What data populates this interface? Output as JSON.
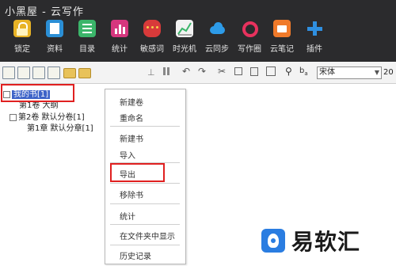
{
  "app": {
    "title": "小黑屋 - 云写作"
  },
  "ribbon": {
    "items": [
      {
        "label": "锁定",
        "icon": "lock-icon",
        "color": "#e8b326"
      },
      {
        "label": "资料",
        "icon": "book-icon",
        "color": "#2b8fd6"
      },
      {
        "label": "目录",
        "icon": "list-icon",
        "color": "#3bb56a"
      },
      {
        "label": "统计",
        "icon": "stats-icon",
        "color": "#d6367e"
      },
      {
        "label": "敏感词",
        "icon": "sensitive-words-icon",
        "color": "#d83a3a"
      },
      {
        "label": "时光机",
        "icon": "time-machine-icon",
        "color": "#e8e8e8"
      },
      {
        "label": "云同步",
        "icon": "cloud-sync-icon",
        "color": "#2d9be8"
      },
      {
        "label": "写作圈",
        "icon": "circle-icon",
        "color": "#e8325e"
      },
      {
        "label": "云笔记",
        "icon": "note-icon",
        "color": "#f07a2a"
      },
      {
        "label": "插件",
        "icon": "plugin-plus-icon",
        "color": "#2f8fe0"
      }
    ]
  },
  "toolbar": {
    "font_name": "宋体",
    "font_size": "20"
  },
  "tree": {
    "book": "我的书[1]",
    "vol1_ch": "第1卷 大纲",
    "vol2": "第2卷 默认分卷[1]",
    "ch1": "第1章 默认分章[1]"
  },
  "menu": {
    "new_volume": "新建卷",
    "rename": "重命名",
    "new_book": "新建书",
    "import": "导入",
    "export": "导出",
    "remove_book": "移除书",
    "stats": "统计",
    "show_in_folder": "在文件夹中显示",
    "history": "历史记录"
  },
  "watermark": {
    "text": "易软汇"
  }
}
